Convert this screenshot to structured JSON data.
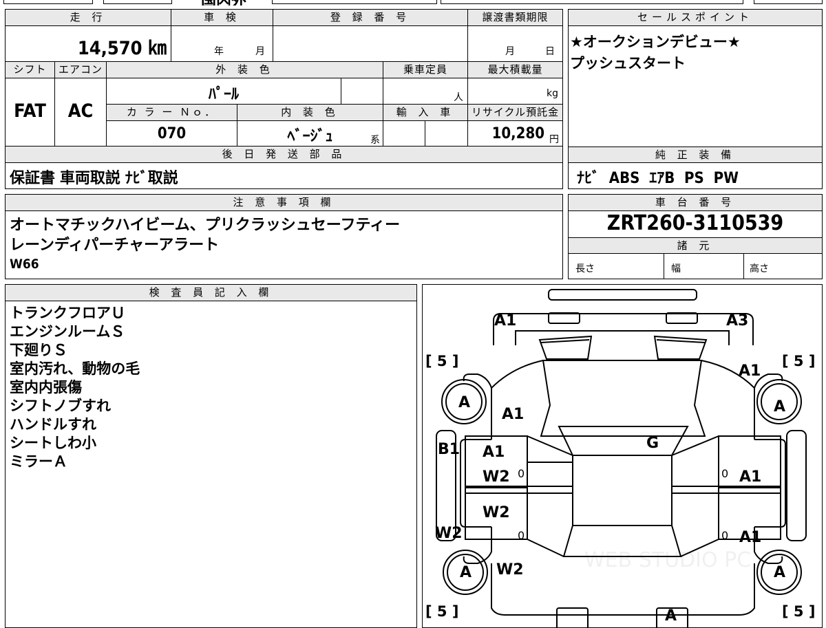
{
  "top_strip": {
    "title": "国内外"
  },
  "mileage": {
    "label": "走 行",
    "value": "14,570 ㎞"
  },
  "shaken": {
    "label": "車 検",
    "year_label": "年",
    "month_label": "月"
  },
  "registration": {
    "label": "登 録 番 号"
  },
  "transfer_deadline": {
    "label": "譲渡書類期限",
    "month_label": "月",
    "day_label": "日"
  },
  "shift": {
    "label": "シフト",
    "value": "FAT"
  },
  "aircon": {
    "label": "エアコン",
    "value": "AC"
  },
  "exterior_color": {
    "label": "外 装 色",
    "value": "ﾊﾟｰﾙ"
  },
  "capacity": {
    "label": "乗車定員",
    "unit": "人"
  },
  "max_load": {
    "label": "最大積載量",
    "unit": "kg"
  },
  "color_no": {
    "label": "カ ラ ー Ｎｏ．",
    "value": "070"
  },
  "interior_color": {
    "label": "内 装 色",
    "value": "ﾍﾞｰｼﾞｭ",
    "suffix": "系"
  },
  "import": {
    "label": "輸 入 車"
  },
  "recycle": {
    "label": "リサイクル預託金",
    "value": "10,280",
    "unit": "円"
  },
  "later_parts": {
    "label": "後 日 発 送 部 品",
    "value": "保証書 車両取説 ﾅﾋﾞ取説"
  },
  "sales_points": {
    "label": "セールスポイント",
    "lines": [
      "★オークションデビュー★",
      "プッシュスタート"
    ]
  },
  "equipment": {
    "label": "純 正 装 備",
    "value": "ﾅﾋﾞ  ABS  ｴｱB  PS  PW"
  },
  "notes": {
    "label": "注 意 事 項 欄",
    "lines": [
      "オートマチックハイビーム、プリクラッシュセーフティー",
      "レーンディパーチャーアラート",
      "W66"
    ]
  },
  "chassis": {
    "label": "車 台 番 号",
    "value": "ZRT260-3110539"
  },
  "specs": {
    "label": "諸 元",
    "length_label": "長さ",
    "width_label": "幅",
    "height_label": "高さ"
  },
  "inspector": {
    "label": "検 査 員 記 入 欄",
    "lines": [
      "トランクフロアＵ",
      "エンジンルームＳ",
      "下廻りＳ",
      "室内汚れ、動物の毛",
      "室内内張傷",
      "シフトノブすれ",
      "ハンドルすれ",
      "シートしわ小",
      "ミラーＡ"
    ]
  },
  "diagram": {
    "front_left": "A1",
    "front_right": "A3",
    "tire_fl": "[ 5 ]",
    "tire_fr": "[ 5 ]",
    "tire_rl": "[ 5 ]",
    "tire_rr": "[ 5 ]",
    "fender_r": "A1",
    "hood_l": "A1",
    "windshield": "G",
    "wheel_fl": "A",
    "wheel_fr": "A",
    "wheel_rl": "A",
    "wheel_rr": "A",
    "pillar_l": "B1",
    "door_fl_1": "A1",
    "door_fl_2": "W2",
    "door_rl": "W2",
    "sill_l": "W2",
    "quarter_l": "W2",
    "door_fr": "A1",
    "door_rr": "A1",
    "zero_1": "0",
    "zero_2": "0",
    "zero_3": "0",
    "zero_4": "0",
    "rear": "A",
    "watermark": "WEB STUDIO PC"
  }
}
